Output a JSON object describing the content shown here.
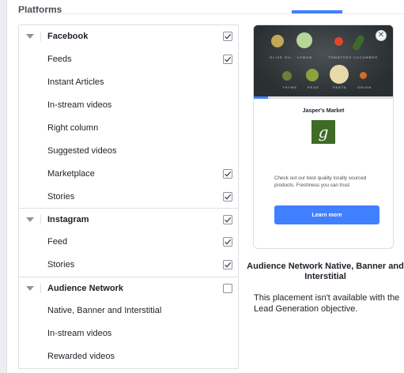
{
  "section": {
    "title": "Platforms"
  },
  "platforms": [
    {
      "label": "Facebook",
      "checked": true,
      "items": [
        {
          "label": "Feeds",
          "checked": true
        },
        {
          "label": "Instant Articles",
          "checked": false
        },
        {
          "label": "In-stream videos",
          "checked": false
        },
        {
          "label": "Right column",
          "checked": false
        },
        {
          "label": "Suggested videos",
          "checked": false
        },
        {
          "label": "Marketplace",
          "checked": true
        },
        {
          "label": "Stories",
          "checked": true
        }
      ]
    },
    {
      "label": "Instagram",
      "checked": true,
      "items": [
        {
          "label": "Feed",
          "checked": true
        },
        {
          "label": "Stories",
          "checked": true
        }
      ]
    },
    {
      "label": "Audience Network",
      "checked": false,
      "items": [
        {
          "label": "Native, Banner and Interstitial",
          "checked": false
        },
        {
          "label": "In-stream videos",
          "checked": false
        },
        {
          "label": "Rewarded videos",
          "checked": false
        }
      ]
    }
  ],
  "preview": {
    "close_glyph": "✕",
    "veg_captions": [
      "OLIVE OIL",
      "LEMON",
      "TOMATOES",
      "CUCUMBER",
      "THYME",
      "PEAS",
      "PASTA",
      "ONION"
    ],
    "progress": 0.1,
    "brand": "Jasper's Market",
    "logo_letter": "g",
    "ad_text": "Check out our best quality locally sourced products. Freshness you can trust.",
    "cta": "Learn more"
  },
  "info": {
    "title": "Audience Network Native, Banner and Interstitial",
    "body": "This placement isn't available with the Lead Generation objective."
  },
  "colors": {
    "accent": "#4080ff",
    "logo_bg": "#3e6b25",
    "border": "#dddfe2"
  }
}
